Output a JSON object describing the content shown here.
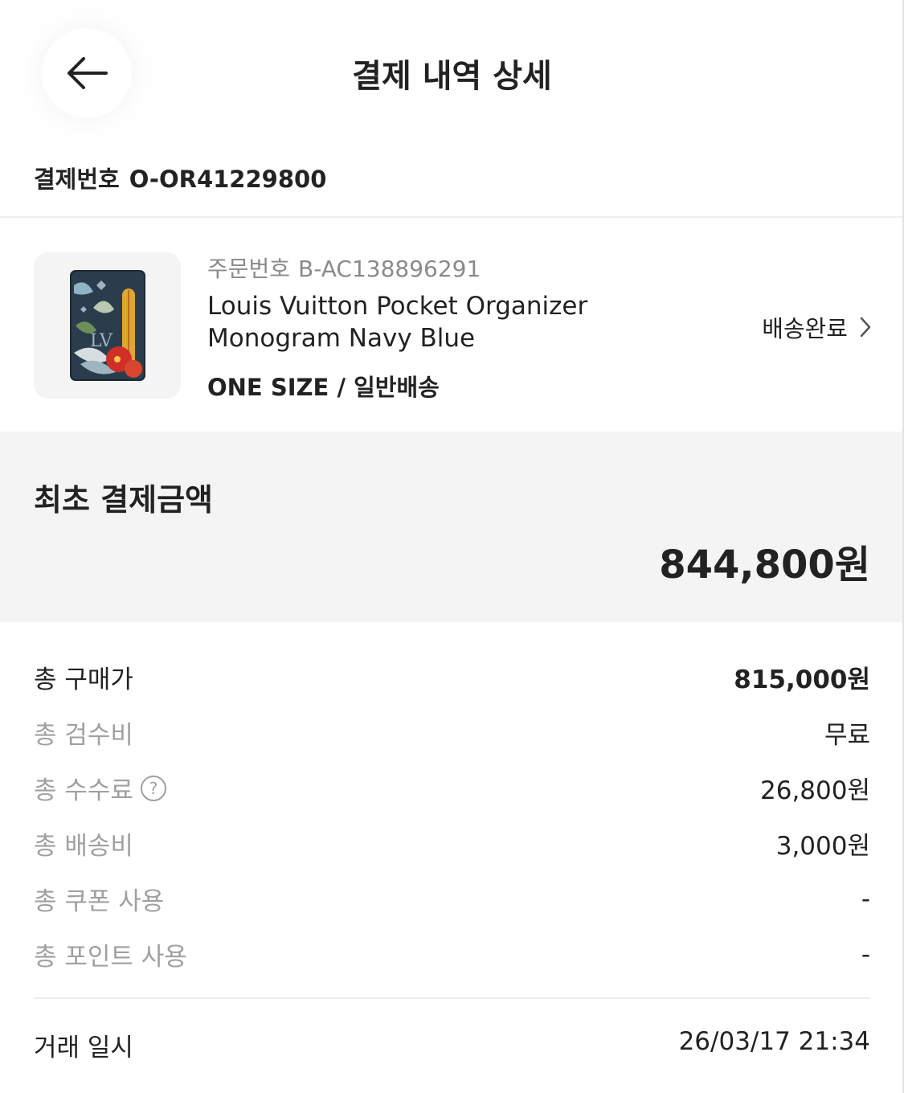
{
  "header": {
    "title": "결제 내역 상세",
    "back_icon": "arrow-left-icon"
  },
  "payment": {
    "number_label": "결제번호",
    "number_value": "O-OR41229800"
  },
  "product": {
    "order_label": "주문번호",
    "order_value": "B-AC138896291",
    "name": "Louis Vuitton Pocket Organizer Monogram Navy Blue",
    "option": "ONE SIZE / 일반배송",
    "status": "배송완료",
    "status_icon": "chevron-right-icon",
    "image_icon": "product-thumbnail-icon"
  },
  "summary": {
    "label": "최초 결제금액",
    "value": "844,800원"
  },
  "breakdown": [
    {
      "label": "총 구매가",
      "value": "815,000원"
    },
    {
      "label": "총 검수비",
      "value": "무료"
    },
    {
      "label": "총 수수료",
      "value": "26,800원"
    },
    {
      "label": "총 배송비",
      "value": "3,000원"
    },
    {
      "label": "총 쿠폰 사용",
      "value": "-"
    },
    {
      "label": "총 포인트 사용",
      "value": "-"
    }
  ],
  "transaction": {
    "label": "거래 일시",
    "value": "26/03/17 21:34"
  },
  "colors": {
    "text": "#222222",
    "muted": "#a0a0a0",
    "band": "#f4f4f4"
  }
}
